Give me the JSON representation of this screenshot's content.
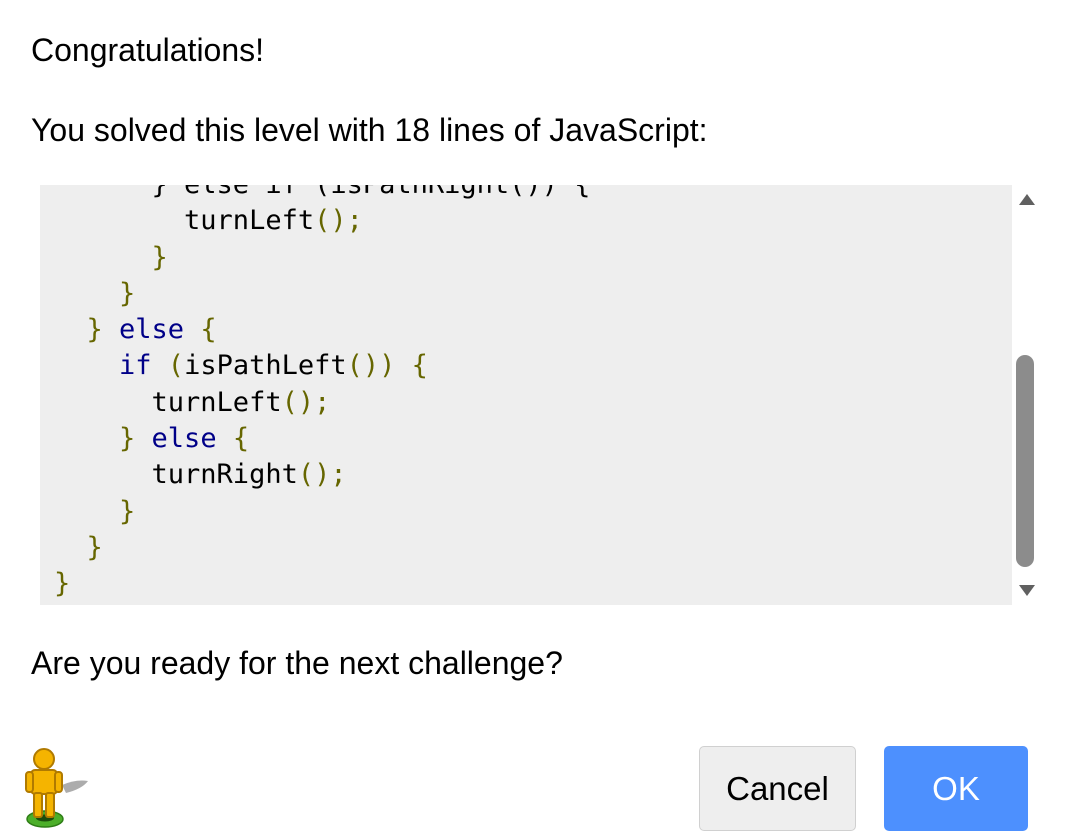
{
  "dialog": {
    "heading": "Congratulations!",
    "summary": "You solved this level with 18 lines of JavaScript:",
    "question": "Are you ready for the next challenge?"
  },
  "code": {
    "language": "JavaScript",
    "line_count": 18,
    "visible_lines": [
      {
        "segments": [
          {
            "t": "      } else if (isPathRight()) {",
            "c": "pl"
          }
        ]
      },
      {
        "segments": [
          {
            "t": "        turnLeft",
            "c": "pl"
          },
          {
            "t": "();",
            "c": "br"
          }
        ]
      },
      {
        "segments": [
          {
            "t": "      }",
            "c": "br"
          }
        ]
      },
      {
        "segments": [
          {
            "t": "    }",
            "c": "br"
          }
        ]
      },
      {
        "segments": [
          {
            "t": "  } ",
            "c": "br"
          },
          {
            "t": "else",
            "c": "kw"
          },
          {
            "t": " {",
            "c": "br"
          }
        ]
      },
      {
        "segments": [
          {
            "t": "    ",
            "c": "pl"
          },
          {
            "t": "if",
            "c": "kw"
          },
          {
            "t": " (",
            "c": "br"
          },
          {
            "t": "isPathLeft",
            "c": "pl"
          },
          {
            "t": "()) {",
            "c": "br"
          }
        ]
      },
      {
        "segments": [
          {
            "t": "      turnLeft",
            "c": "pl"
          },
          {
            "t": "();",
            "c": "br"
          }
        ]
      },
      {
        "segments": [
          {
            "t": "    } ",
            "c": "br"
          },
          {
            "t": "else",
            "c": "kw"
          },
          {
            "t": " {",
            "c": "br"
          }
        ]
      },
      {
        "segments": [
          {
            "t": "      turnRight",
            "c": "pl"
          },
          {
            "t": "();",
            "c": "br"
          }
        ]
      },
      {
        "segments": [
          {
            "t": "    }",
            "c": "br"
          }
        ]
      },
      {
        "segments": [
          {
            "t": "  }",
            "c": "br"
          }
        ]
      },
      {
        "segments": [
          {
            "t": "}",
            "c": "br"
          }
        ]
      }
    ]
  },
  "buttons": {
    "cancel_label": "Cancel",
    "ok_label": "OK"
  },
  "colors": {
    "ok_button": "#4d90fe",
    "code_background": "#eeeeee",
    "keyword": "#000088",
    "punctuation": "#666600"
  },
  "icons": {
    "mascot": "pegman-icon",
    "scroll_up": "triangle-up-icon",
    "scroll_down": "triangle-down-icon"
  }
}
